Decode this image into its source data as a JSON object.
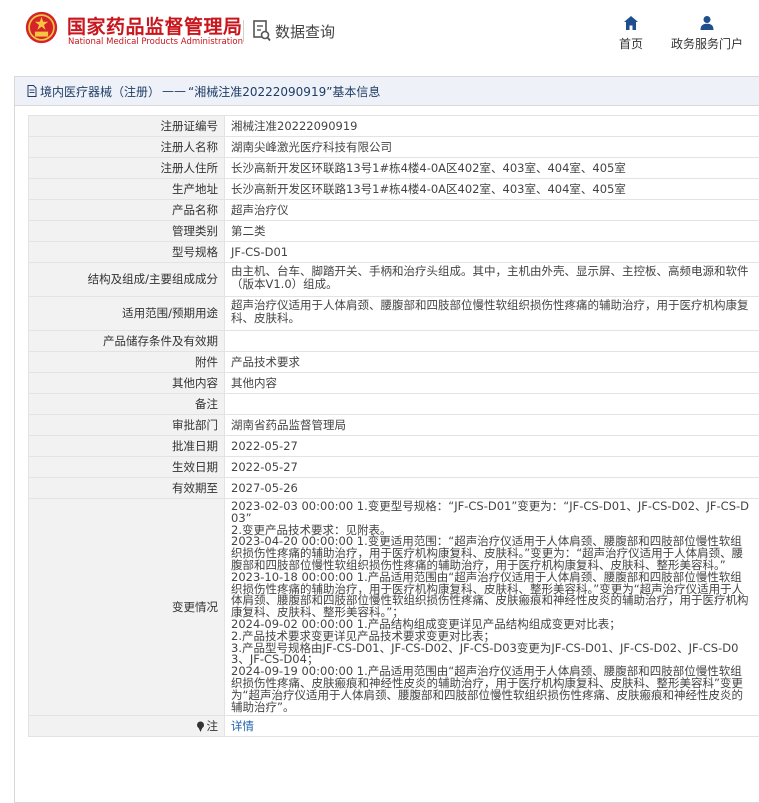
{
  "header": {
    "title_cn": "国家药品监督管理局",
    "title_en": "National Medical Products Administration",
    "data_query": "数据查询",
    "nav": {
      "home": "首页",
      "gov_portal": "政务服务门户"
    }
  },
  "breadcrumb": {
    "category": "境内医疗器械（注册）",
    "separator": "——",
    "record": "“湘械注准20222090919”基本信息"
  },
  "fields": [
    {
      "label": "注册证编号",
      "value": "湘械注准20222090919"
    },
    {
      "label": "注册人名称",
      "value": "湖南尖峰激光医疗科技有限公司"
    },
    {
      "label": "注册人住所",
      "value": "长沙高新开发区环联路13号1#栋4楼4-0A区402室、403室、404室、405室"
    },
    {
      "label": "生产地址",
      "value": "长沙高新开发区环联路13号1#栋4楼4-0A区402室、403室、404室、405室"
    },
    {
      "label": "产品名称",
      "value": "超声治疗仪"
    },
    {
      "label": "管理类别",
      "value": "第二类"
    },
    {
      "label": "型号规格",
      "value": "JF-CS-D01"
    },
    {
      "label": "结构及组成/主要组成成分",
      "value": "由主机、台车、脚踏开关、手柄和治疗头组成。其中，主机由外壳、显示屏、主控板、高频电源和软件（版本V1.0）组成。"
    },
    {
      "label": "适用范围/预期用途",
      "value": "超声治疗仪适用于人体肩颈、腰腹部和四肢部位慢性软组织损伤性疼痛的辅助治疗，用于医疗机构康复科、皮肤科。"
    },
    {
      "label": "产品储存条件及有效期",
      "value": ""
    },
    {
      "label": "附件",
      "value": "产品技术要求"
    },
    {
      "label": "其他内容",
      "value": "其他内容"
    },
    {
      "label": "备注",
      "value": ""
    },
    {
      "label": "审批部门",
      "value": "湖南省药品监督管理局"
    },
    {
      "label": "批准日期",
      "value": "2022-05-27"
    },
    {
      "label": "生效日期",
      "value": "2022-05-27"
    },
    {
      "label": "有效期至",
      "value": "2027-05-26"
    }
  ],
  "changes": {
    "label": "变更情况",
    "lines": [
      "2023-02-03 00:00:00 1.变更型号规格：“JF-CS-D01”变更为：“JF-CS-D01、JF-CS-D02、JF-CS-D03”",
      "2.变更产品技术要求：见附表。",
      "2023-04-20 00:00:00 1.变更适用范围：“超声治疗仪适用于人体肩颈、腰腹部和四肢部位慢性软组织损伤性疼痛的辅助治疗，用于医疗机构康复科、皮肤科。”变更为：“超声治疗仪适用于人体肩颈、腰腹部和四肢部位慢性软组织损伤性疼痛的辅助治疗，用于医疗机构康复科、皮肤科、整形美容科。”",
      "2023-10-18 00:00:00 1.产品适用范围由“超声治疗仪适用于人体肩颈、腰腹部和四肢部位慢性软组织损伤性疼痛的辅助治疗，用于医疗机构康复科、皮肤科、整形美容科。”变更为“超声治疗仪适用于人体肩颈、腰腹部和四肢部位慢性软组织损伤性疼痛、皮肤瘢痕和神经性皮炎的辅助治疗，用于医疗机构康复科、皮肤科、整形美容科。”；",
      "2024-09-02 00:00:00 1.产品结构组成变更详见产品结构组成变更对比表；",
      "2.产品技术要求变更详见产品技术要求变更对比表；",
      "3.产品型号规格由JF-CS-D01、JF-CS-D02、JF-CS-D03变更为JF-CS-D01、JF-CS-D02、JF-CS-D03、JF-CS-D04；",
      "2024-09-19 00:00:00 1.产品适用范围由“超声治疗仪适用于人体肩颈、腰腹部和四肢部位慢性软组织损伤性疼痛、皮肤瘢痕和神经性皮炎的辅助治疗，用于医疗机构康复科、皮肤科、整形美容科”变更为“超声治疗仪适用于人体肩颈、腰腹部和四肢部位慢性软组织损伤性疼痛、皮肤瘢痕和神经性皮炎的辅助治疗”。"
    ]
  },
  "note": {
    "label": "注",
    "link": "详情"
  },
  "colors": {
    "brand_red": "#c8161d",
    "nav_blue": "#1f3c66",
    "link_blue": "#1e5fb0"
  },
  "icons": [
    "emblem-logo",
    "data-query-icon",
    "home-icon",
    "user-icon",
    "document-icon",
    "pin-icon"
  ]
}
